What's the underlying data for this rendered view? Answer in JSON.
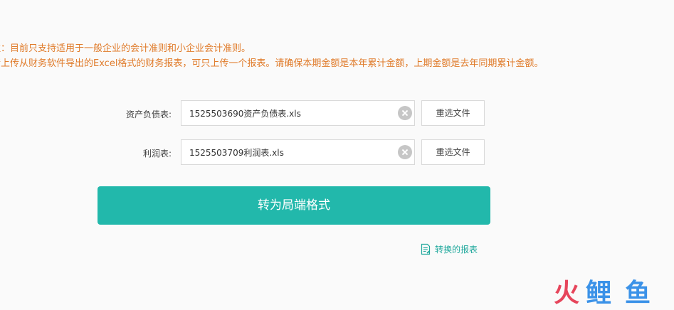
{
  "notices": {
    "line1": "注：目前只支持适用于一般企业的会计准则和小企业会计准则。",
    "line2": "请上传从财务软件导出的Excel格式的财务报表，可只上传一个报表。请确保本期金额是本年累计金额，上期金额是去年同期累计金额。"
  },
  "upload": {
    "rows": [
      {
        "label": "资产负债表:",
        "file_name": "1525503690资产负债表.xls",
        "reselect_label": "重选文件"
      },
      {
        "label": "利润表:",
        "file_name": "1525503709利润表.xls",
        "reselect_label": "重选文件"
      }
    ]
  },
  "actions": {
    "convert_label": "转为局端格式",
    "converted_reports_label": "转换的报表"
  },
  "watermark": {
    "text1": "火",
    "text2": "鲤",
    "text3": "鱼"
  },
  "colors": {
    "accent": "#22b8ab",
    "notice": "#e07b2a",
    "link": "#1fa89c",
    "watermark_red": "#e6455b",
    "watermark_blue": "#3b92e8"
  },
  "icons": {
    "clear": "clear-circle-icon",
    "converted_reports": "document-icon"
  }
}
